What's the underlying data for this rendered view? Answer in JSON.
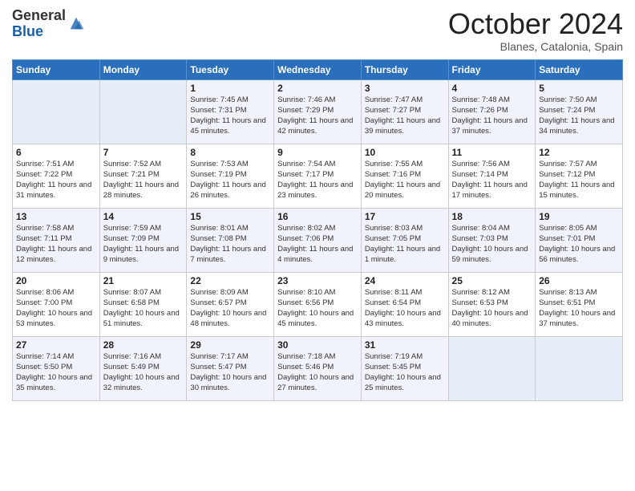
{
  "header": {
    "logo_general": "General",
    "logo_blue": "Blue",
    "month_title": "October 2024",
    "location": "Blanes, Catalonia, Spain"
  },
  "days_of_week": [
    "Sunday",
    "Monday",
    "Tuesday",
    "Wednesday",
    "Thursday",
    "Friday",
    "Saturday"
  ],
  "weeks": [
    [
      {
        "day": "",
        "info": ""
      },
      {
        "day": "",
        "info": ""
      },
      {
        "day": "1",
        "info": "Sunrise: 7:45 AM\nSunset: 7:31 PM\nDaylight: 11 hours and 45 minutes."
      },
      {
        "day": "2",
        "info": "Sunrise: 7:46 AM\nSunset: 7:29 PM\nDaylight: 11 hours and 42 minutes."
      },
      {
        "day": "3",
        "info": "Sunrise: 7:47 AM\nSunset: 7:27 PM\nDaylight: 11 hours and 39 minutes."
      },
      {
        "day": "4",
        "info": "Sunrise: 7:48 AM\nSunset: 7:26 PM\nDaylight: 11 hours and 37 minutes."
      },
      {
        "day": "5",
        "info": "Sunrise: 7:50 AM\nSunset: 7:24 PM\nDaylight: 11 hours and 34 minutes."
      }
    ],
    [
      {
        "day": "6",
        "info": "Sunrise: 7:51 AM\nSunset: 7:22 PM\nDaylight: 11 hours and 31 minutes."
      },
      {
        "day": "7",
        "info": "Sunrise: 7:52 AM\nSunset: 7:21 PM\nDaylight: 11 hours and 28 minutes."
      },
      {
        "day": "8",
        "info": "Sunrise: 7:53 AM\nSunset: 7:19 PM\nDaylight: 11 hours and 26 minutes."
      },
      {
        "day": "9",
        "info": "Sunrise: 7:54 AM\nSunset: 7:17 PM\nDaylight: 11 hours and 23 minutes."
      },
      {
        "day": "10",
        "info": "Sunrise: 7:55 AM\nSunset: 7:16 PM\nDaylight: 11 hours and 20 minutes."
      },
      {
        "day": "11",
        "info": "Sunrise: 7:56 AM\nSunset: 7:14 PM\nDaylight: 11 hours and 17 minutes."
      },
      {
        "day": "12",
        "info": "Sunrise: 7:57 AM\nSunset: 7:12 PM\nDaylight: 11 hours and 15 minutes."
      }
    ],
    [
      {
        "day": "13",
        "info": "Sunrise: 7:58 AM\nSunset: 7:11 PM\nDaylight: 11 hours and 12 minutes."
      },
      {
        "day": "14",
        "info": "Sunrise: 7:59 AM\nSunset: 7:09 PM\nDaylight: 11 hours and 9 minutes."
      },
      {
        "day": "15",
        "info": "Sunrise: 8:01 AM\nSunset: 7:08 PM\nDaylight: 11 hours and 7 minutes."
      },
      {
        "day": "16",
        "info": "Sunrise: 8:02 AM\nSunset: 7:06 PM\nDaylight: 11 hours and 4 minutes."
      },
      {
        "day": "17",
        "info": "Sunrise: 8:03 AM\nSunset: 7:05 PM\nDaylight: 11 hours and 1 minute."
      },
      {
        "day": "18",
        "info": "Sunrise: 8:04 AM\nSunset: 7:03 PM\nDaylight: 10 hours and 59 minutes."
      },
      {
        "day": "19",
        "info": "Sunrise: 8:05 AM\nSunset: 7:01 PM\nDaylight: 10 hours and 56 minutes."
      }
    ],
    [
      {
        "day": "20",
        "info": "Sunrise: 8:06 AM\nSunset: 7:00 PM\nDaylight: 10 hours and 53 minutes."
      },
      {
        "day": "21",
        "info": "Sunrise: 8:07 AM\nSunset: 6:58 PM\nDaylight: 10 hours and 51 minutes."
      },
      {
        "day": "22",
        "info": "Sunrise: 8:09 AM\nSunset: 6:57 PM\nDaylight: 10 hours and 48 minutes."
      },
      {
        "day": "23",
        "info": "Sunrise: 8:10 AM\nSunset: 6:56 PM\nDaylight: 10 hours and 45 minutes."
      },
      {
        "day": "24",
        "info": "Sunrise: 8:11 AM\nSunset: 6:54 PM\nDaylight: 10 hours and 43 minutes."
      },
      {
        "day": "25",
        "info": "Sunrise: 8:12 AM\nSunset: 6:53 PM\nDaylight: 10 hours and 40 minutes."
      },
      {
        "day": "26",
        "info": "Sunrise: 8:13 AM\nSunset: 6:51 PM\nDaylight: 10 hours and 37 minutes."
      }
    ],
    [
      {
        "day": "27",
        "info": "Sunrise: 7:14 AM\nSunset: 5:50 PM\nDaylight: 10 hours and 35 minutes."
      },
      {
        "day": "28",
        "info": "Sunrise: 7:16 AM\nSunset: 5:49 PM\nDaylight: 10 hours and 32 minutes."
      },
      {
        "day": "29",
        "info": "Sunrise: 7:17 AM\nSunset: 5:47 PM\nDaylight: 10 hours and 30 minutes."
      },
      {
        "day": "30",
        "info": "Sunrise: 7:18 AM\nSunset: 5:46 PM\nDaylight: 10 hours and 27 minutes."
      },
      {
        "day": "31",
        "info": "Sunrise: 7:19 AM\nSunset: 5:45 PM\nDaylight: 10 hours and 25 minutes."
      },
      {
        "day": "",
        "info": ""
      },
      {
        "day": "",
        "info": ""
      }
    ]
  ]
}
